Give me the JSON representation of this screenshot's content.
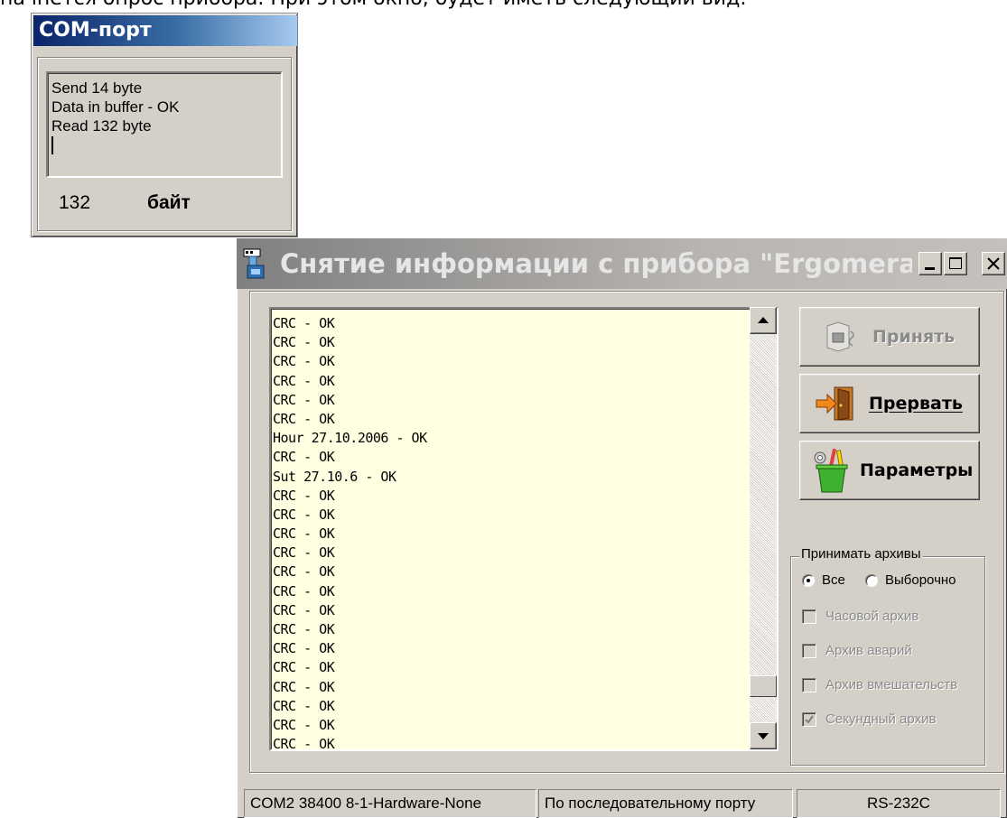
{
  "document": {
    "partial_text": "начнется опрос прибора. При этом окно, будет иметь следующий вид:"
  },
  "com_window": {
    "title": "COM-порт",
    "log_lines": [
      "Send 14 byte",
      "Data in buffer - OK",
      "Read 132 byte"
    ],
    "byte_count": "132",
    "byte_unit": "байт"
  },
  "main_window": {
    "title": "Снятие информации с прибора \"Ergomera...",
    "caption_buttons": [
      "minimize-icon",
      "maximize-icon",
      "close-icon"
    ],
    "log": {
      "lines": [
        "CRC - OK",
        "CRC - OK",
        "CRC - OK",
        "CRC - OK",
        "CRC - OK",
        "CRC - OK",
        "Hour 27.10.2006 - OK",
        "CRC - OK",
        "Sut 27.10.6 - OK",
        "CRC - OK",
        "CRC - OK",
        "CRC - OK",
        "CRC - OK",
        "CRC - OK",
        "CRC - OK",
        "CRC - OK",
        "CRC - OK",
        "CRC - OK",
        "CRC - OK",
        "CRC - OK",
        "CRC - OK",
        "CRC - OK",
        "CRC - OK"
      ],
      "scroll_position": 0.93
    },
    "buttons": {
      "accept": {
        "label": "Принять",
        "enabled": false,
        "icon": "receive-data-icon"
      },
      "abort": {
        "label": "Прервать",
        "enabled": true,
        "icon": "exit-door-icon"
      },
      "params": {
        "label": "Параметры",
        "enabled": true,
        "icon": "tools-cup-icon"
      }
    },
    "archives": {
      "title": "Принимать архивы",
      "mode_all": "Все",
      "mode_selective": "Выборочно",
      "selected_mode": "Все",
      "options": [
        {
          "label": "Часовой архив",
          "checked": false,
          "enabled": false
        },
        {
          "label": "Архив аварий",
          "checked": false,
          "enabled": false
        },
        {
          "label": "Архив вмешательств",
          "checked": false,
          "enabled": false
        },
        {
          "label": "Секундный архив",
          "checked": true,
          "enabled": false
        }
      ]
    },
    "status_bar": {
      "port_settings": "COM2 38400 8-1-Hardware-None",
      "connection": "По последовательному порту",
      "interface": "RS-232C"
    }
  }
}
